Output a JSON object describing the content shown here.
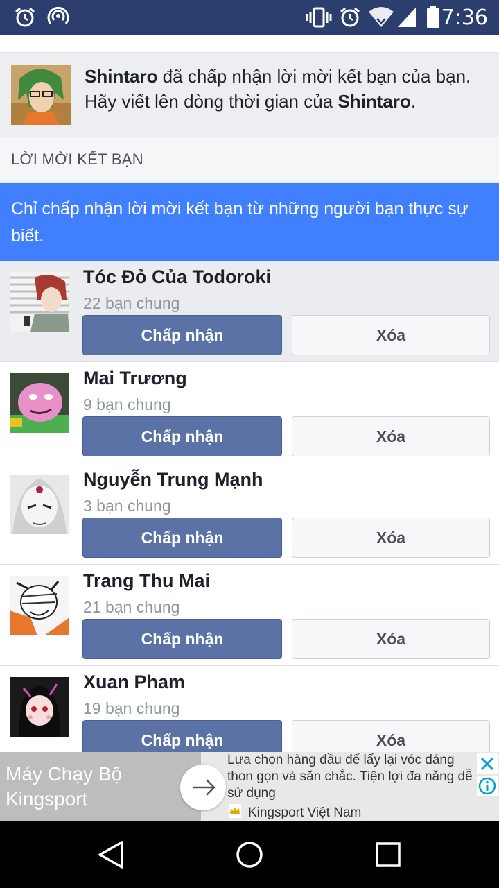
{
  "status_bar": {
    "time": "7:36",
    "icons": [
      "alarm-icon",
      "wifi-hotspot-icon",
      "vibrate-icon",
      "alarm-icon",
      "wifi-icon",
      "cellular-signal-icon",
      "battery-icon"
    ]
  },
  "notification": {
    "name_1": "Shintaro",
    "text_1": " đã chấp nhận lời mời kết bạn của bạn. Hãy viết lên dòng thời gian của ",
    "name_2": "Shintaro",
    "text_2": "."
  },
  "section": {
    "title": "LỜI MỜI KẾT BẠN"
  },
  "tip": {
    "text": "Chỉ chấp nhận lời mời kết bạn từ những người bạn thực sự biết."
  },
  "requests": [
    {
      "name": "Tóc Đỏ Của Todoroki",
      "mutual": "22 bạn chung",
      "accept": "Chấp nhận",
      "delete": "Xóa"
    },
    {
      "name": "Mai Trương",
      "mutual": "9 bạn chung",
      "accept": "Chấp nhận",
      "delete": "Xóa"
    },
    {
      "name": "Nguyễn Trung Mạnh",
      "mutual": "3 bạn chung",
      "accept": "Chấp nhận",
      "delete": "Xóa"
    },
    {
      "name": "Trang Thu Mai",
      "mutual": "21 bạn chung",
      "accept": "Chấp nhận",
      "delete": "Xóa"
    },
    {
      "name": "Xuan Pham",
      "mutual": "19 bạn chung",
      "accept": "Chấp nhận",
      "delete": "Xóa"
    }
  ],
  "ad": {
    "title": "Máy Chạy Bộ Kingsport",
    "description": "Lựa chọn hàng đầu để lấy lại vóc dáng thon gọn và săn chắc. Tiện lợi đa năng dễ sử dụng",
    "brand": "Kingsport Việt Nam"
  },
  "colors": {
    "status_bar": "#2c3e6d",
    "tip_banner": "#4080ff",
    "accept_button": "#5b72a7"
  }
}
